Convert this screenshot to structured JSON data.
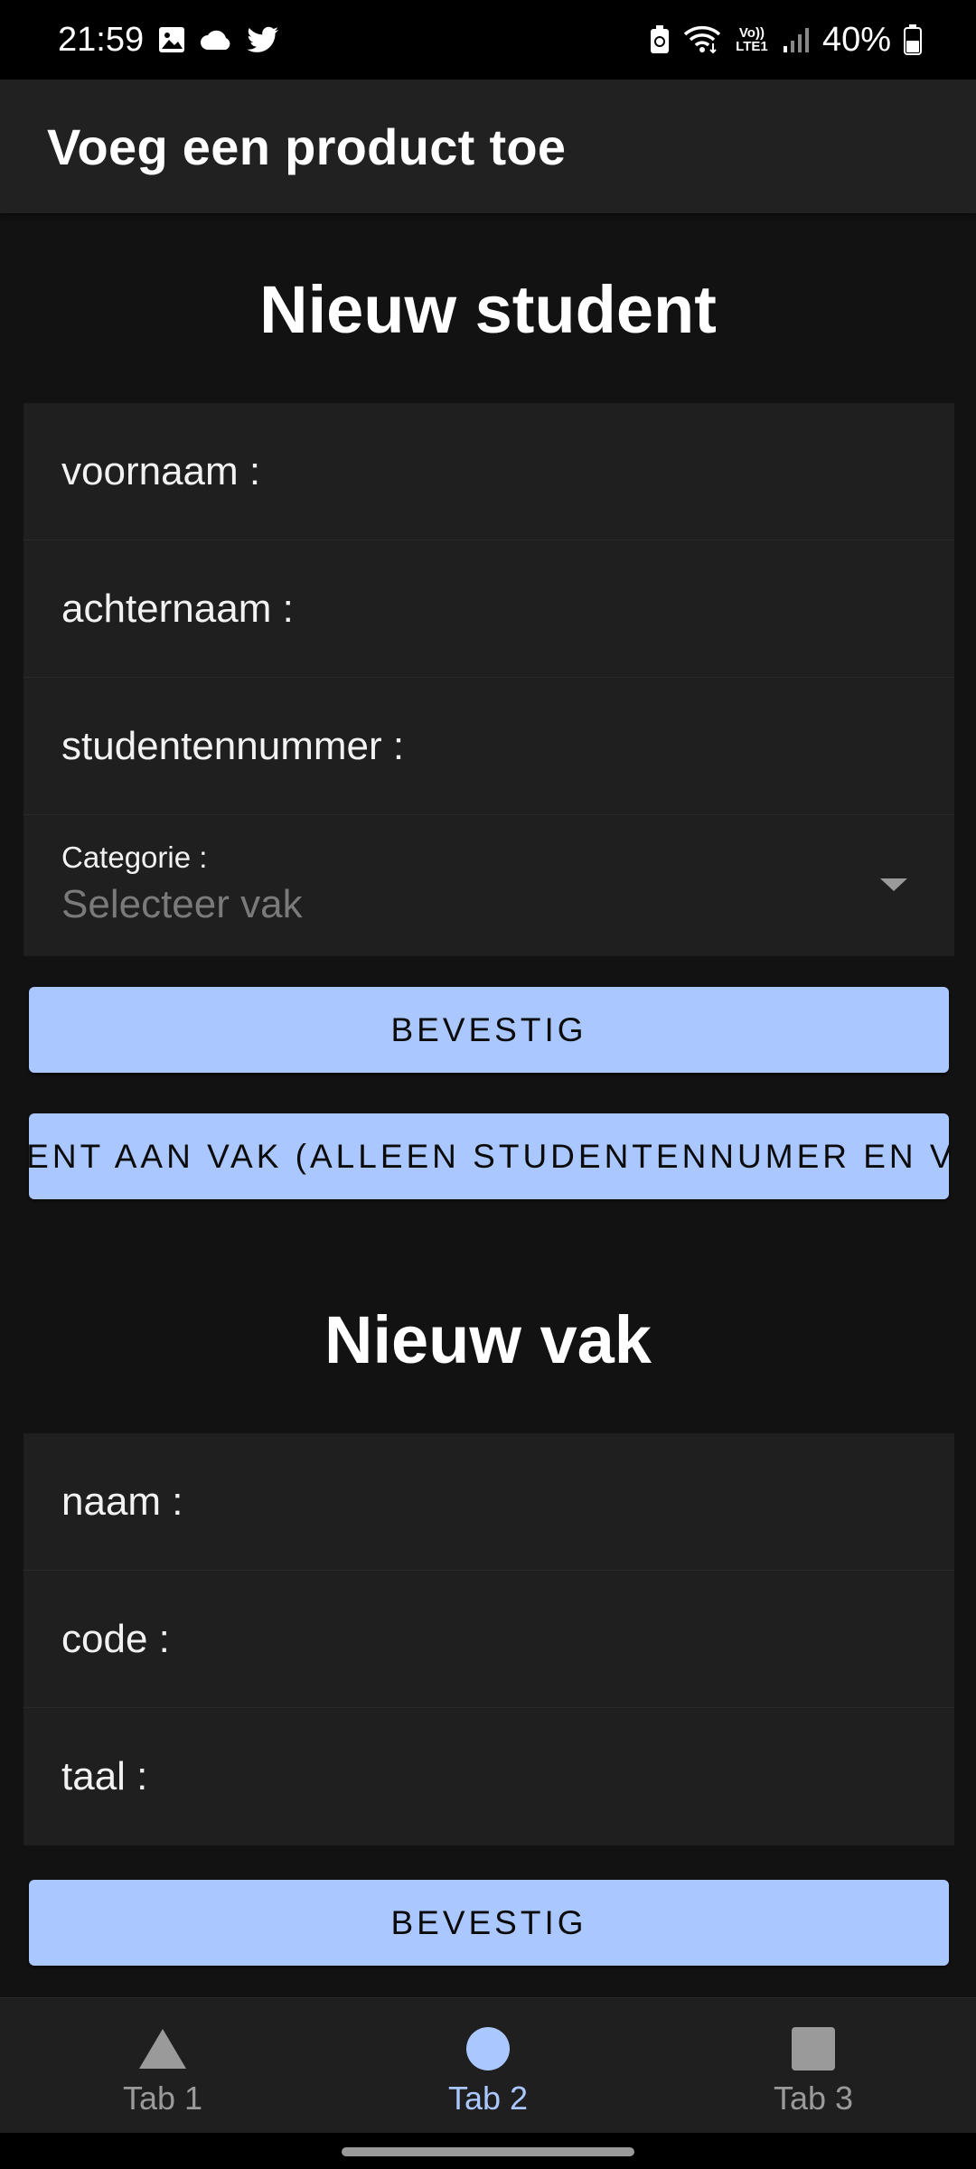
{
  "status_bar": {
    "time": "21:59",
    "left_icons": [
      "gallery-icon",
      "cloud-icon",
      "twitter-icon"
    ],
    "right_icons": [
      "battery-saver-icon",
      "wifi-icon",
      "volte-icon",
      "signal-icon",
      "battery-icon"
    ],
    "volte_text": "Vo)) LTE1",
    "battery_percent": "40%"
  },
  "app_bar": {
    "title": "Voeg een product toe"
  },
  "student_section": {
    "title": "Nieuw student",
    "fields": [
      {
        "label": "voornaam :"
      },
      {
        "label": "achternaam :"
      },
      {
        "label": "studentennummer :"
      }
    ],
    "category": {
      "label": "Categorie :",
      "placeholder": "Selecteer vak"
    },
    "confirm_label": "BEVESTIG",
    "assign_label": "DENT AAN VAK (ALLEEN STUDENTENNUMER EN VA"
  },
  "course_section": {
    "title": "Nieuw vak",
    "fields": [
      {
        "label": "naam :"
      },
      {
        "label": "code :"
      },
      {
        "label": "taal :"
      }
    ],
    "confirm_label": "BEVESTIG"
  },
  "tabs": [
    {
      "label": "Tab 1",
      "icon": "triangle-icon",
      "active": false
    },
    {
      "label": "Tab 2",
      "icon": "circle-icon",
      "active": true
    },
    {
      "label": "Tab 3",
      "icon": "square-icon",
      "active": false
    }
  ],
  "colors": {
    "accent": "#aac7ff",
    "background": "#121212",
    "surface": "#1f1f1f",
    "app_bar": "#212121"
  }
}
